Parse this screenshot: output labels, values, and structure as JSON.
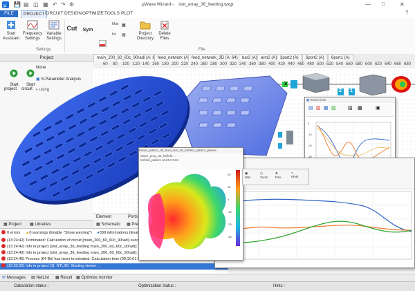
{
  "app": {
    "title": "slot_array_36_feeding.wxgr",
    "app_name": "µWave Wizard",
    "window_controls": [
      "—",
      "□",
      "✕"
    ]
  },
  "menu": {
    "items": [
      {
        "label": "FILE"
      },
      {
        "label": "PROJECT"
      },
      {
        "label": "CIRCUIT"
      },
      {
        "label": "DESIGN"
      },
      {
        "label": "OPTIMIZE"
      },
      {
        "label": "TOOLS"
      },
      {
        "label": "PLOT"
      }
    ]
  },
  "ribbon": {
    "buttons": [
      {
        "label": "Start\nAssistant"
      },
      {
        "label": "Frequency\nSettings"
      },
      {
        "label": "Variable\nSettings"
      },
      {
        "label": "Cut"
      },
      {
        "label": "Sym"
      },
      {
        "label": "Project\nDirectory"
      },
      {
        "label": "Delete\nFiles"
      }
    ],
    "groups": [
      {
        "label": "Settings"
      },
      {
        "label": "File"
      }
    ]
  },
  "doc_tabs": [
    {
      "label": "main_200_60_60c_90radi (A: 64)"
    },
    {
      "label": "feed_network (A: 64)"
    },
    {
      "label": "feed_network_3D (A: 64)"
    },
    {
      "label": "bar2 (A)"
    },
    {
      "label": "arm2 (A)"
    },
    {
      "label": "3port2 (A)"
    },
    {
      "label": "6port2 (A)"
    },
    {
      "label": "6port1 (A)"
    }
  ],
  "ruler": {
    "ticks": [
      "60",
      "80",
      "100",
      "120",
      "140",
      "160",
      "180",
      "200",
      "220",
      "240",
      "260",
      "280",
      "300",
      "320",
      "340",
      "360",
      "380",
      "400",
      "420",
      "440",
      "460",
      "480",
      "500",
      "520",
      "540",
      "560",
      "580",
      "600",
      "620",
      "640",
      "660",
      "680",
      "700",
      "720"
    ]
  },
  "project_panel": {
    "header": "Project",
    "start_project": "Start\nproject",
    "start_circuit": "Start\ncircuit",
    "none_option": "None",
    "analysis": "S-Parameter Analysis",
    "using": "using",
    "bottom_tabs": [
      {
        "label": "Project"
      },
      {
        "label": "Libraries"
      }
    ]
  },
  "element_panel": {
    "element_label": "Element",
    "ports_label": "Ports",
    "schematic_tab": "Schematic",
    "prev_tab": "Prev"
  },
  "messages": {
    "summary": [
      {
        "label": "0 errors"
      },
      {
        "label": "0 warnings (Enable \"Show warning\")"
      },
      {
        "label": "399 informations (Enable \"Show info\")"
      }
    ],
    "rows": [
      {
        "time": "(13:24:42)",
        "text": "Terminated: Calculation of circuit [main_200_60_60c_90radi] successfully terminated"
      },
      {
        "time": "(13:24:42)",
        "text": "Info in project [slot_array_36_feeding main_200_60_60c_90radi]: Calculation done"
      },
      {
        "time": "(13:24:42)",
        "text": "Info in project [slot_array_36_feeding main_200_60_60c_90radi]: Elapsed time 00:00:03.6"
      },
      {
        "time": "(13:24:45)",
        "text": "Process (64 Bit) has been terminated: Calculation time (00:10:01 058)"
      },
      {
        "time": "(13:33:30)",
        "text": "Info in project [1]: NTL3D: Starting viewer ...",
        "selected": true
      }
    ],
    "tabs": [
      {
        "label": "Messages"
      },
      {
        "label": "NetList"
      },
      {
        "label": "Result"
      },
      {
        "label": "Optimize monitor"
      }
    ]
  },
  "status": {
    "calc": "Calculation status :",
    "opt": "Optimization status :",
    "hints": "Hints :"
  },
  "viewer3d": {
    "title": "Wave_pattern_36_feed_slot_36_farfield_pattern_planes",
    "lines": [
      "Wave_prop_36_farfield ...",
      "farfield_pattern at 24.0 GHz"
    ]
  },
  "farfield": {
    "colorbar_labels": [
      "20",
      "10",
      "0",
      "-10",
      "-20",
      "-30"
    ]
  },
  "plot_small": {
    "title": "Return loss",
    "toolbar": [
      "Ma",
      "Ze",
      "Pa",
      "Hi"
    ],
    "ylabels": [
      "0",
      "-10",
      "-20",
      "-30",
      "-40"
    ],
    "xlabels": [
      "23",
      "23.5",
      "24",
      "24.5",
      "25"
    ]
  },
  "plot_large": {
    "xlabels": [
      "60",
      "80",
      "100",
      "120",
      "140"
    ]
  },
  "toolbar3d": [
    "Max",
    "Zoom",
    "Pan",
    "Hints"
  ],
  "ports": [
    {
      "label": "1"
    },
    {
      "label": "2"
    },
    {
      "label": "3"
    },
    {
      "label": "1"
    },
    {
      "label": "2"
    },
    {
      "label": "1"
    },
    {
      "label": "1"
    }
  ],
  "colors": {
    "accent": "#2b6cc7",
    "antenna_blue": "#1f4fd8",
    "feed_blue": "#6f86e8",
    "curve_blue": "#2c63c5",
    "curve_orange": "#f07a2c",
    "curve_green": "#2fa62f",
    "error_red": "#d92b2b"
  }
}
